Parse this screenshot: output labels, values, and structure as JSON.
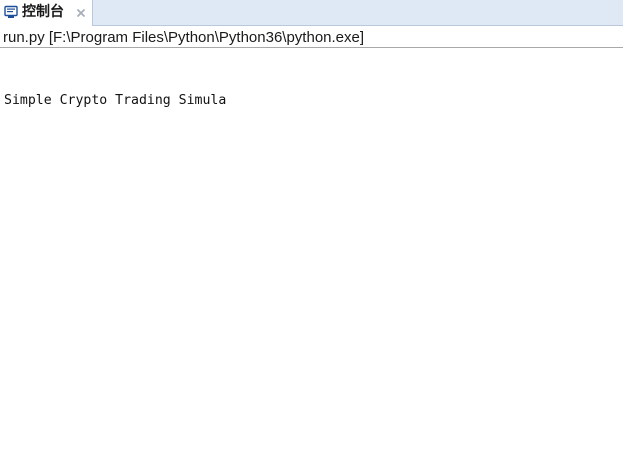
{
  "tab": {
    "label": "控制台",
    "icon": "console-icon",
    "close_icon": "close-icon"
  },
  "process": {
    "label": "run.py [F:\\Program Files\\Python\\Python36\\python.exe]"
  },
  "console": {
    "lines": [
      "",
      "Simple Crypto Trading Simula"
    ]
  },
  "colors": {
    "tabbar_bg": "#dfe9f5",
    "tab_border": "#b9c8db",
    "icon_blue": "#1f4e9a"
  }
}
